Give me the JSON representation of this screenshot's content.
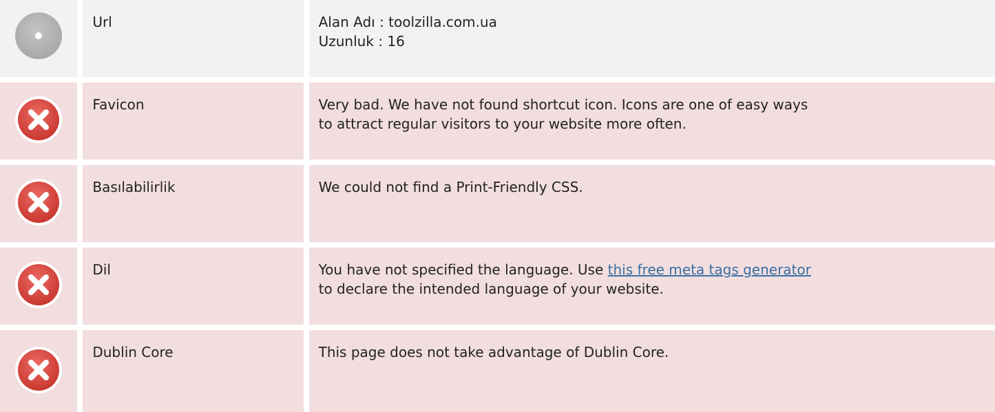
{
  "rows": [
    {
      "status": "neutral",
      "status_icon": "neutral-dot-icon",
      "name": "Url",
      "lines": [
        "Alan Adı : toolzilla.com.ua",
        "Uzunluk : 16"
      ]
    },
    {
      "status": "bad",
      "status_icon": "error-x-icon",
      "name": "Favicon",
      "lines": [
        "Very bad. We have not found shortcut icon. Icons are one of easy ways",
        "to attract regular visitors to your website more often."
      ]
    },
    {
      "status": "bad",
      "status_icon": "error-x-icon",
      "name": "Basılabilirlik",
      "lines": [
        "We could not find a Print-Friendly CSS."
      ]
    },
    {
      "status": "bad",
      "status_icon": "error-x-icon",
      "name": "Dil",
      "text_before_link": "You have not specified the language. Use ",
      "link_text": "this free meta tags generator",
      "text_after_link": "to declare the intended language of your website."
    },
    {
      "status": "bad",
      "status_icon": "error-x-icon",
      "name": "Dublin Core",
      "lines": [
        "This page does not take advantage of Dublin Core."
      ]
    }
  ],
  "colors": {
    "neutral_bg": "#f2f2f2",
    "bad_bg": "#f2dedf",
    "error_red": "#d9534f",
    "link": "#3a6fa3"
  }
}
